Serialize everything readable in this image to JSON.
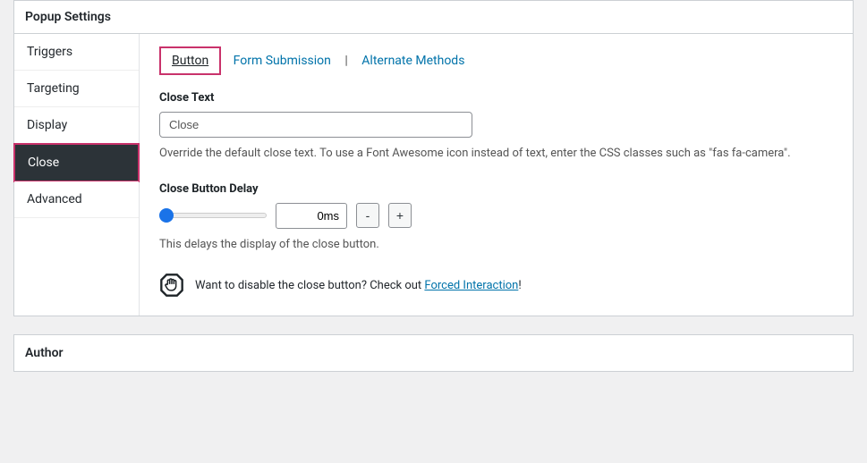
{
  "panel_title": "Popup Settings",
  "sidebar": {
    "items": [
      {
        "label": "Triggers"
      },
      {
        "label": "Targeting"
      },
      {
        "label": "Display"
      },
      {
        "label": "Close"
      },
      {
        "label": "Advanced"
      }
    ]
  },
  "subtabs": {
    "button": "Button",
    "form": "Form Submission",
    "alt": "Alternate Methods"
  },
  "close_text": {
    "label": "Close Text",
    "value": "Close",
    "help": "Override the default close text. To use a Font Awesome icon instead of text, enter the CSS classes such as \"fas fa-camera\"."
  },
  "close_delay": {
    "label": "Close Button Delay",
    "value": "0ms",
    "minus": "-",
    "plus": "+",
    "help": "This delays the display of the close button."
  },
  "tip": {
    "prefix": "Want to disable the close button? Check out ",
    "link": "Forced Interaction",
    "suffix": "!"
  },
  "author_title": "Author"
}
